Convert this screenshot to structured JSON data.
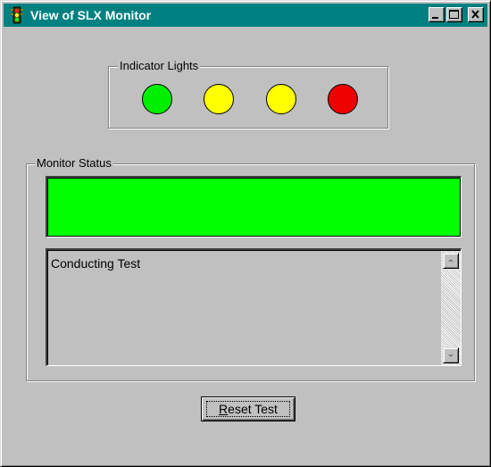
{
  "window": {
    "title": "View of SLX Monitor",
    "title_icon": "traffic-light-icon",
    "controls": [
      "minimize-icon",
      "maximize-icon",
      "close-icon"
    ]
  },
  "indicator_lights": {
    "label": "Indicator Lights",
    "lights": [
      {
        "color": "#00ee00"
      },
      {
        "color": "#ffff00"
      },
      {
        "color": "#ffff00"
      },
      {
        "color": "#ee0000"
      }
    ]
  },
  "monitor_status": {
    "label": "Monitor Status",
    "status_color": "#00ff00",
    "log_text": "Conducting Test",
    "scroll_icons": [
      "scroll-up-icon",
      "scroll-down-icon"
    ]
  },
  "reset_button": {
    "mnemonic": "R",
    "label_rest": "eset Test"
  },
  "colors": {
    "titlebar": "#008080",
    "face": "#c0c0c0"
  }
}
